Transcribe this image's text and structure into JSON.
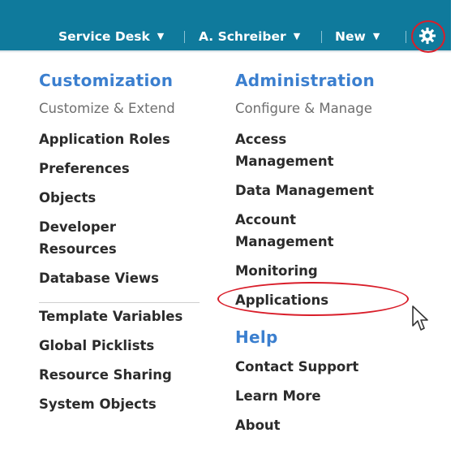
{
  "topbar": {
    "service_desk": "Service Desk",
    "user": "A. Schreiber",
    "new": "New",
    "chevron": "⌄"
  },
  "icons": {
    "settings": "gear-icon",
    "chevron": "chevron-down-icon",
    "cursor": "pointer-cursor-icon"
  },
  "colors": {
    "topbar": "#0f7a9c",
    "section_heading": "#3b7fcf",
    "highlight": "#d91e2a"
  },
  "customization": {
    "title": "Customization",
    "subtitle": "Customize & Extend",
    "items": [
      "Application Roles",
      "Preferences",
      "Objects",
      "Developer Resources",
      "Database Views"
    ],
    "items2": [
      "Template Variables",
      "Global Picklists",
      "Resource Sharing",
      "System Objects"
    ]
  },
  "administration": {
    "title": "Administration",
    "subtitle": "Configure & Manage",
    "items": [
      "Access Management",
      "Data Management",
      "Account Management",
      "Monitoring",
      "Applications"
    ]
  },
  "help": {
    "title": "Help",
    "items": [
      "Contact Support",
      "Learn More",
      "About"
    ]
  }
}
